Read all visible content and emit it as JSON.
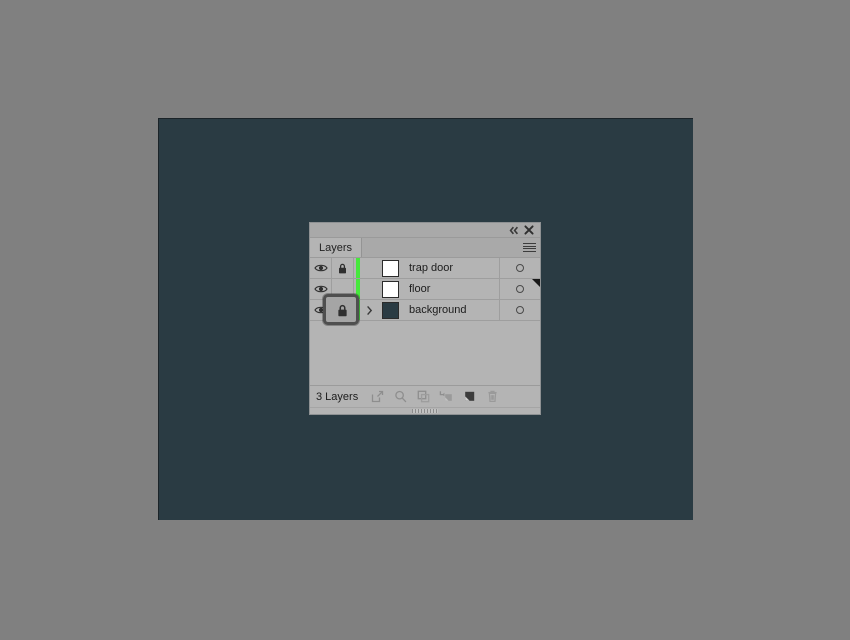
{
  "app": {
    "canvas_color": "#2a3b43",
    "background_color": "#808080"
  },
  "panel": {
    "tab_label": "Layers",
    "collapse_icon": "double-chevron-left-icon",
    "close_icon": "close-x-icon",
    "menu_icon": "panel-menu-icon",
    "panel_bg": "#b4b4b4"
  },
  "layers": {
    "items": [
      {
        "name": "trap door",
        "visible": true,
        "visibility_icon": "eye-icon",
        "locked": true,
        "lock_icon": "lock-closed-icon",
        "color": "#46e83c",
        "thumbnail_color": "#ffffff",
        "has_disclosure": false,
        "disclosure_icon": "",
        "target_icon": "target-circle-icon",
        "selected": false
      },
      {
        "name": "floor",
        "visible": true,
        "visibility_icon": "eye-icon",
        "locked": false,
        "lock_icon": "",
        "color": "#46e83c",
        "thumbnail_color": "#ffffff",
        "has_disclosure": false,
        "disclosure_icon": "",
        "target_icon": "target-circle-icon",
        "selected": true
      },
      {
        "name": "background",
        "visible": true,
        "visibility_icon": "eye-icon",
        "locked": true,
        "lock_icon": "lock-closed-icon",
        "color": "#46e83c",
        "thumbnail_color": "#2a3b43",
        "has_disclosure": true,
        "disclosure_icon": "chevron-right-icon",
        "target_icon": "target-circle-icon",
        "selected": false,
        "lock_focused": true
      }
    ]
  },
  "footer": {
    "count_label": "3 Layers",
    "buttons": [
      {
        "name": "locate-object-button",
        "icon": "locate-object-icon"
      },
      {
        "name": "find-button",
        "icon": "magnifier-icon"
      },
      {
        "name": "make-clipping-mask-button",
        "icon": "clipping-mask-icon"
      },
      {
        "name": "create-new-sublayer-button",
        "icon": "new-sublayer-icon"
      },
      {
        "name": "create-new-layer-button",
        "icon": "new-layer-icon"
      },
      {
        "name": "delete-selection-button",
        "icon": "trash-icon"
      }
    ]
  }
}
